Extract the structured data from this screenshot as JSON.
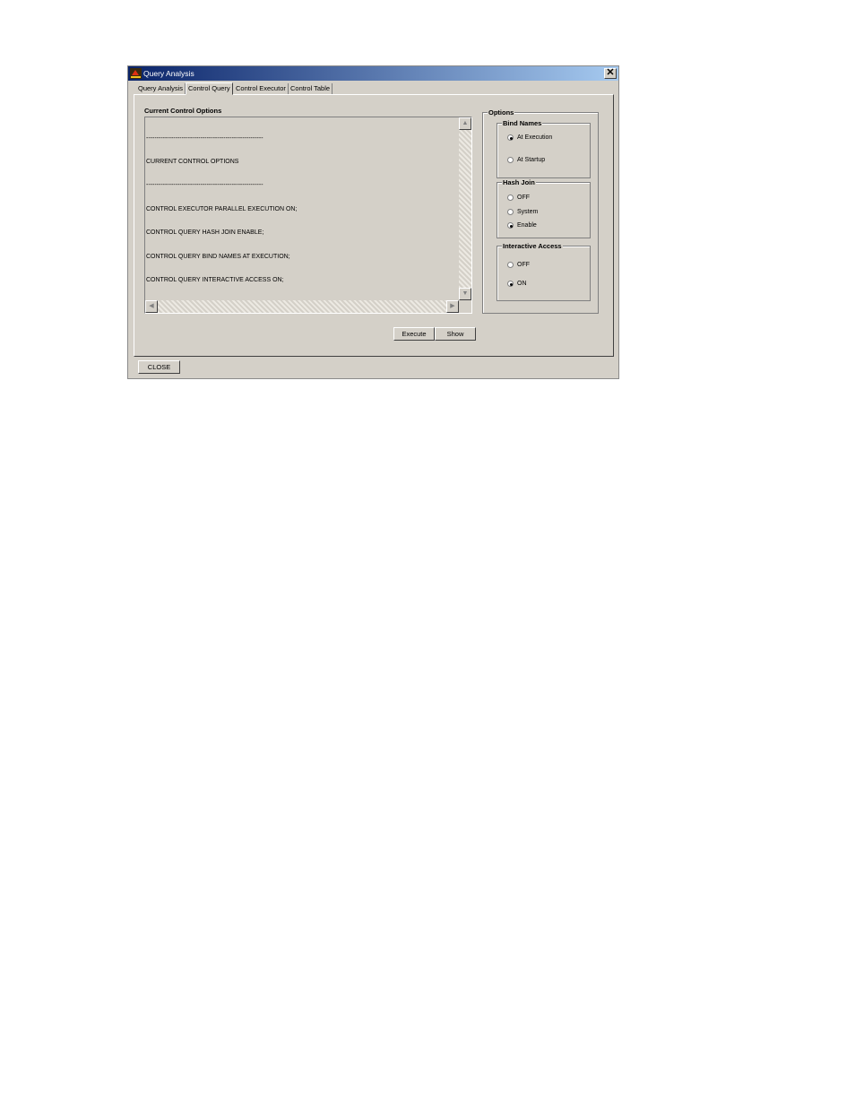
{
  "window": {
    "title": "Query Analysis"
  },
  "tabs": [
    "Query Analysis",
    "Control Query",
    "Control Executor",
    "Control Table"
  ],
  "current_options": {
    "label": "Current Control Options",
    "lines": [
      "--------------------------------------------------------",
      "CURRENT CONTROL OPTIONS",
      "--------------------------------------------------------",
      "CONTROL EXECUTOR PARALLEL EXECUTION ON;",
      "CONTROL QUERY HASH JOIN ENABLE;",
      "CONTROL QUERY BIND NAMES AT EXECUTION;",
      "CONTROL QUERY INTERACTIVE ACCESS ON;"
    ]
  },
  "options": {
    "label": "Options",
    "bind_names": {
      "label": "Bind Names",
      "items": [
        "At Execution",
        "At Startup"
      ],
      "selected": "At Execution"
    },
    "hash_join": {
      "label": "Hash Join",
      "items": [
        "OFF",
        "System",
        "Enable"
      ],
      "selected": "Enable"
    },
    "interactive_access": {
      "label": "Interactive Access",
      "items": [
        "OFF",
        "ON"
      ],
      "selected": "ON"
    }
  },
  "buttons": {
    "execute": "Execute",
    "show": "Show",
    "close": "CLOSE"
  }
}
